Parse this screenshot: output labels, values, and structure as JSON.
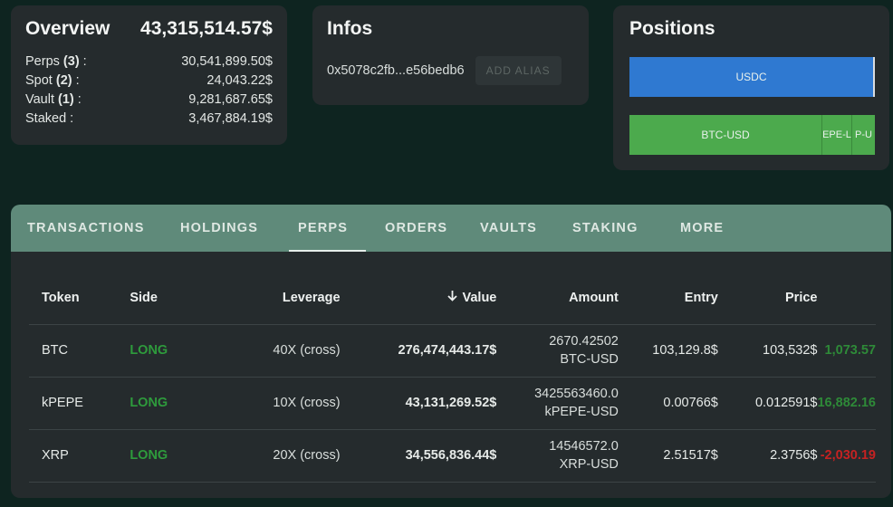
{
  "overview": {
    "title": "Overview",
    "total": "43,315,514.57$",
    "rows": [
      {
        "label": "Perps",
        "count": "(3)",
        "suffix": " :",
        "value": "30,541,899.50$"
      },
      {
        "label": "Spot",
        "count": "(2)",
        "suffix": " :",
        "value": "24,043.22$"
      },
      {
        "label": "Vault",
        "count": "(1)",
        "suffix": " :",
        "value": "9,281,687.65$"
      },
      {
        "label": "Staked",
        "count": "",
        "suffix": " :",
        "value": "3,467,884.19$"
      }
    ]
  },
  "infos": {
    "title": "Infos",
    "address": "0x5078c2fb...e56bedb6",
    "add_alias_label": "ADD ALIAS"
  },
  "positions": {
    "title": "Positions",
    "row1": [
      {
        "label": "USDC"
      }
    ],
    "row2": [
      {
        "label": "BTC-USD"
      },
      {
        "label": "EPE-L"
      },
      {
        "label": "P-U"
      }
    ]
  },
  "tabs": [
    "TRANSACTIONS",
    "HOLDINGS",
    "PERPS",
    "ORDERS",
    "VAULTS",
    "STAKING",
    "MORE"
  ],
  "active_tab": "PERPS",
  "table": {
    "headers": {
      "token": "Token",
      "side": "Side",
      "leverage": "Leverage",
      "value": "Value",
      "amount": "Amount",
      "entry": "Entry",
      "price": "Price"
    },
    "sort_icon": "arrow-down-icon",
    "rows": [
      {
        "token": "BTC",
        "side": "LONG",
        "leverage": "40X (cross)",
        "value": "276,474,443.17$",
        "amount_qty": "2670.42502",
        "amount_pair": "BTC-USD",
        "entry": "103,129.8$",
        "price": "103,532$",
        "pnl": "1,073.57",
        "pnl_sign": "pos"
      },
      {
        "token": "kPEPE",
        "side": "LONG",
        "leverage": "10X (cross)",
        "value": "43,131,269.52$",
        "amount_qty": "3425563460.0",
        "amount_pair": "kPEPE-USD",
        "entry": "0.00766$",
        "price": "0.012591$",
        "pnl": "16,882.16",
        "pnl_sign": "pos"
      },
      {
        "token": "XRP",
        "side": "LONG",
        "leverage": "20X (cross)",
        "value": "34,556,836.44$",
        "amount_qty": "14546572.0",
        "amount_pair": "XRP-USD",
        "entry": "2.51517$",
        "price": "2.3756$",
        "pnl": "-2,030.19",
        "pnl_sign": "neg"
      }
    ]
  },
  "colors": {
    "background": "#0e2420",
    "card": "#252b2d",
    "tab_bar": "#5f8a7a",
    "long": "#2e9b3c",
    "usdc_bar": "#2f79d1",
    "perp_bar": "#4caa4d",
    "negative": "#c52222"
  }
}
